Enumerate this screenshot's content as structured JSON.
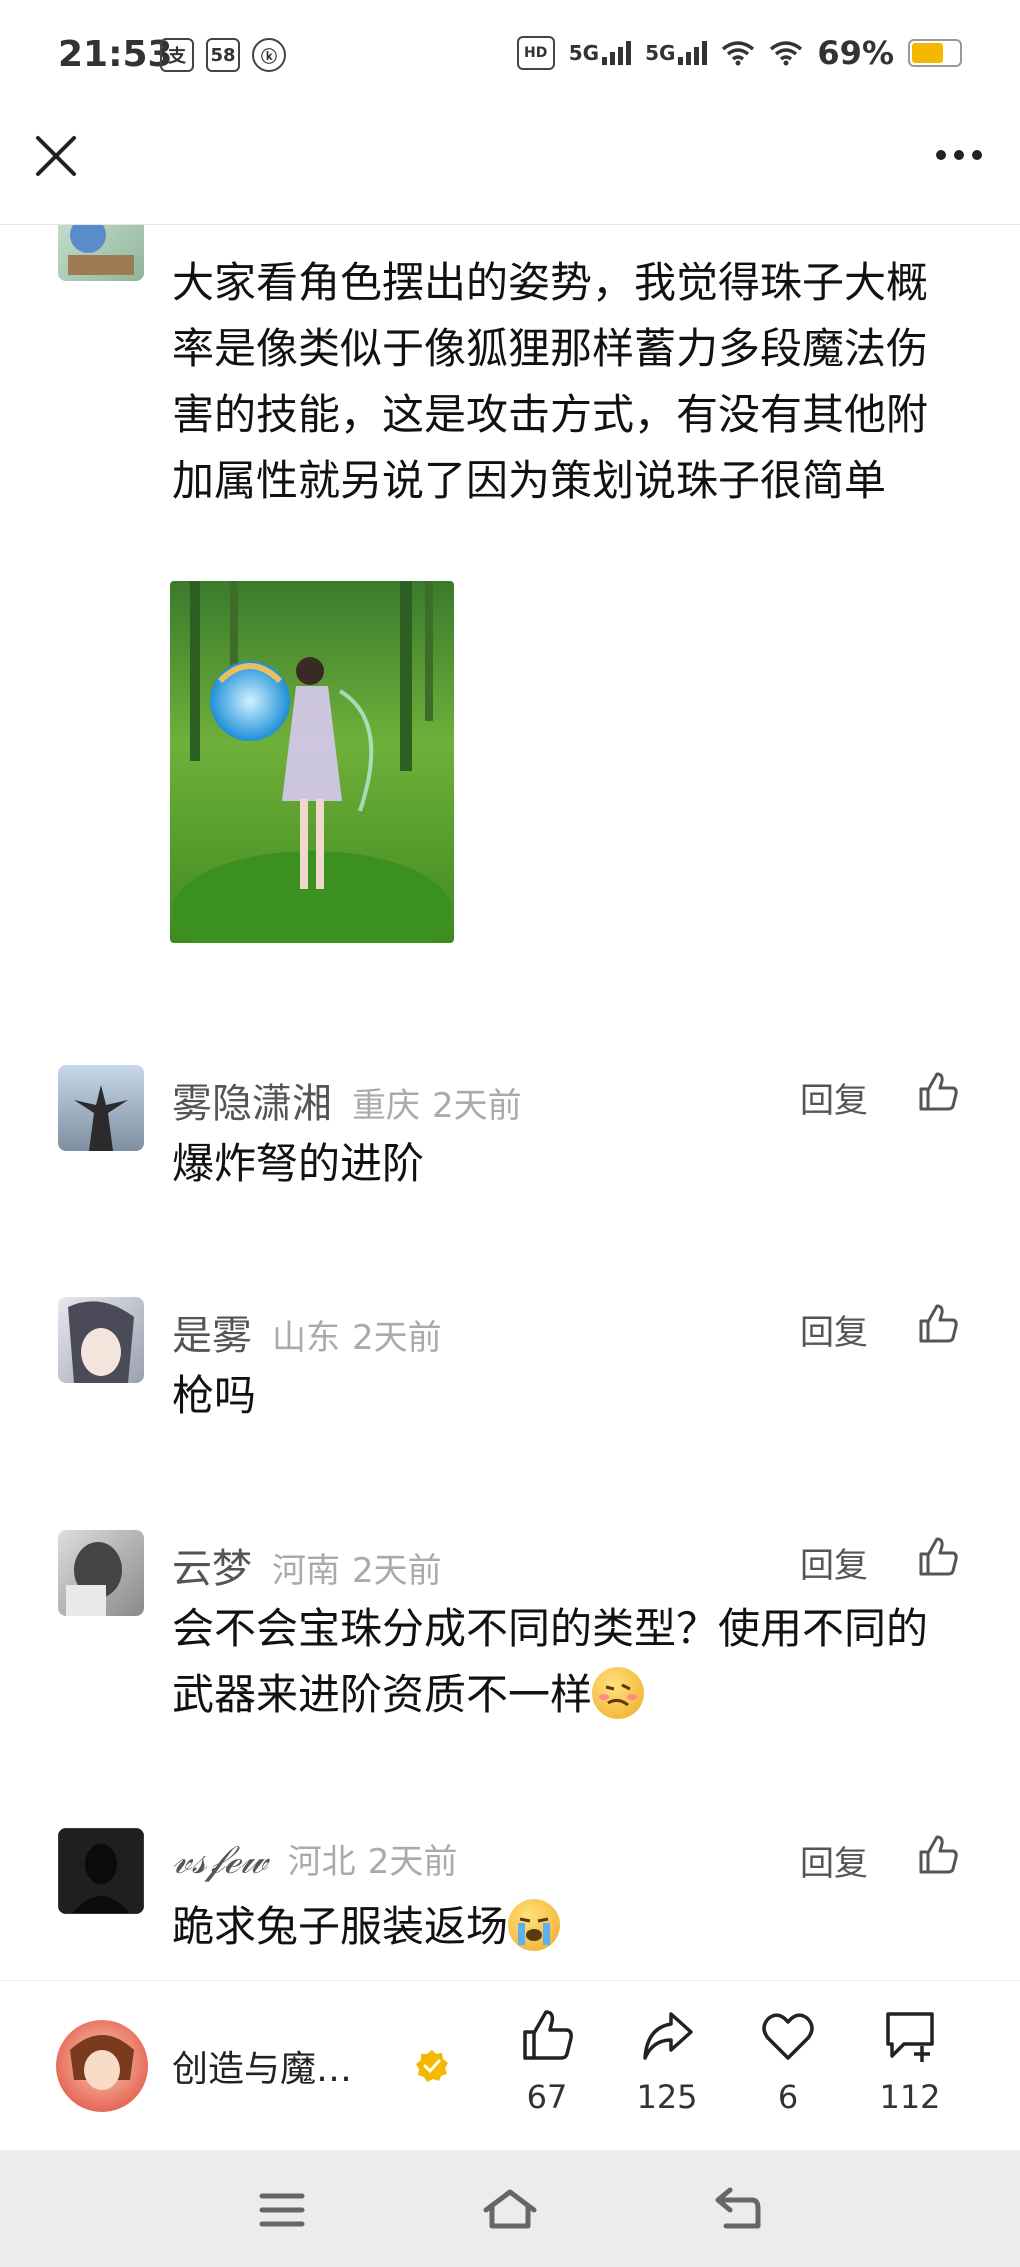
{
  "status_bar": {
    "time": "21:53",
    "left_icons": [
      "支",
      "58",
      "ⓚ"
    ],
    "hd_label": "HD",
    "signal1": "5G",
    "signal2": "5G",
    "battery": "69%",
    "battery_level": 0.69
  },
  "comments": [
    {
      "text": "大家看角色摆出的姿势，我觉得珠子大概率是像类似于像狐狸那样蓄力多段魔法伤害的技能，这是攻击方式，有没有其他附加属性就另说了因为策划说珠子很简单"
    },
    {
      "username": "雾隐潇湘",
      "location": "重庆",
      "time": "2天前",
      "reply": "回复",
      "text": "爆炸弩的进阶"
    },
    {
      "username": "是雾",
      "location": "山东",
      "time": "2天前",
      "reply": "回复",
      "text": "枪吗"
    },
    {
      "username": "云梦",
      "location": "河南",
      "time": "2天前",
      "reply": "回复",
      "text": "会不会宝珠分成不同的类型？使用不同的武器来进阶资质不一样"
    },
    {
      "username": "𝓋𝓈𝒻ℯ𝓌",
      "location": "河北",
      "time": "2天前",
      "reply": "回复",
      "text": "跪求兔子服装返场"
    }
  ],
  "bottom_bar": {
    "author_name": "创造与魔…",
    "likes": "67",
    "shares": "125",
    "favorites": "6",
    "comments": "112"
  },
  "colors": {
    "accent_battery": "#f5b800",
    "verified": "#f5b800"
  }
}
